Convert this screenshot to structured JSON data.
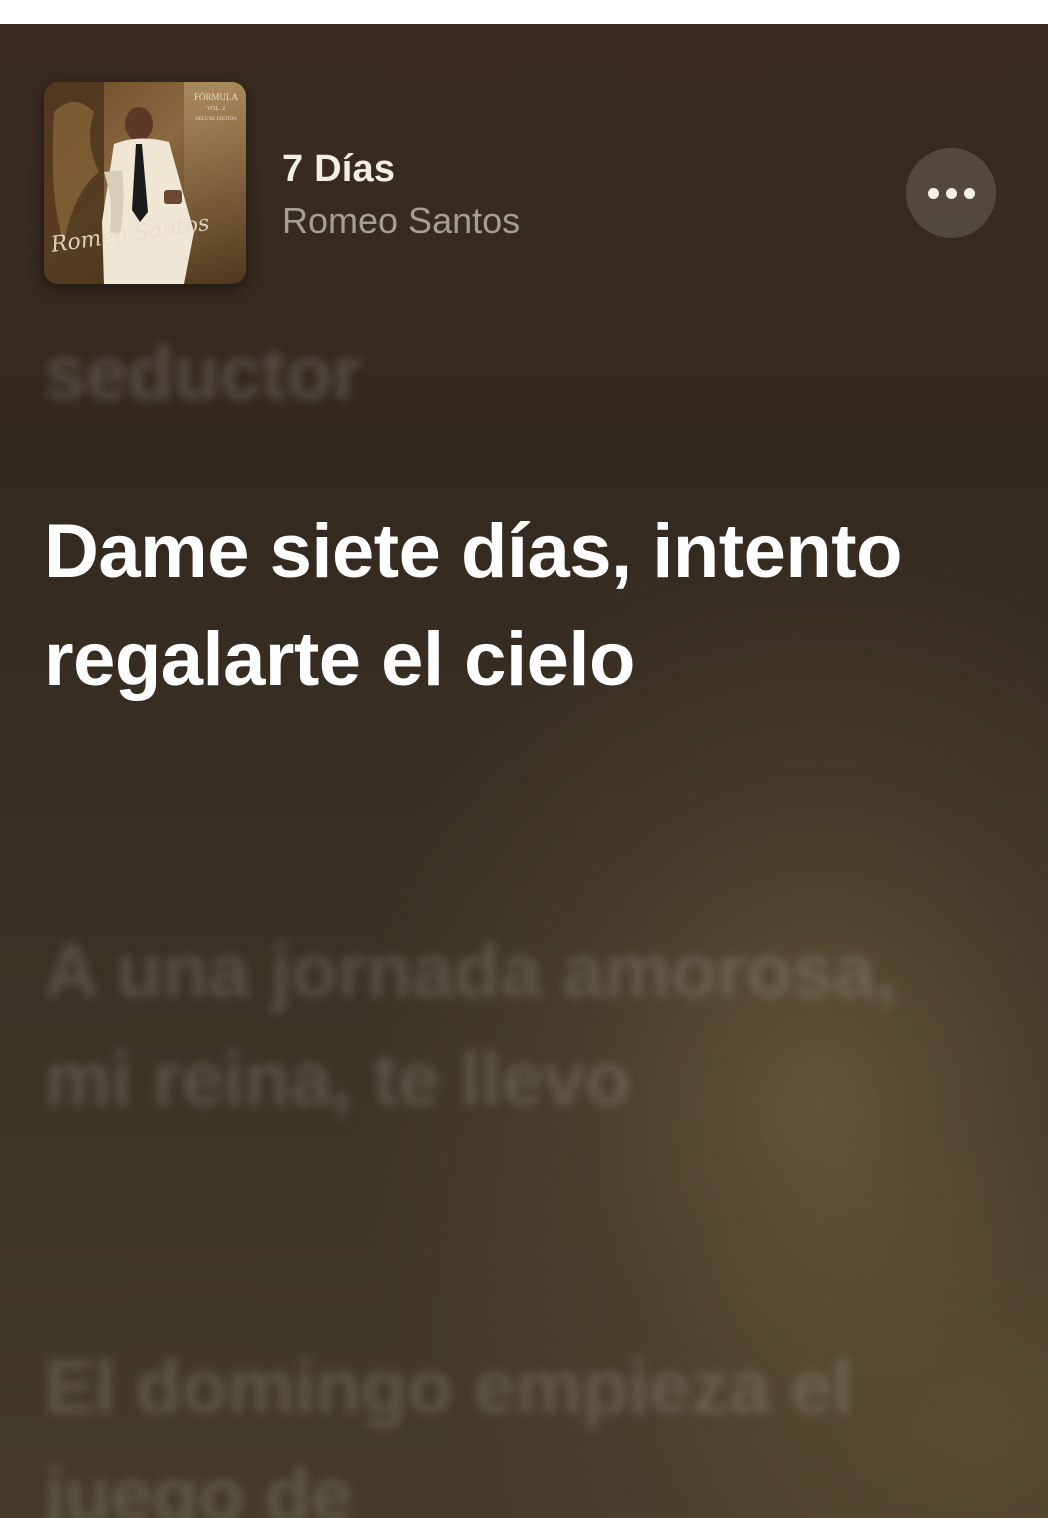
{
  "now_playing": {
    "title": "7 Días",
    "artist": "Romeo Santos",
    "artwork": {
      "album_label": "FÓRMULA",
      "volume": "VOL. 2",
      "edition": "DELUXE EDITION",
      "artist_script": "Romeo Santos"
    },
    "more_icon": "ellipsis-icon"
  },
  "lyrics": {
    "previous": "seductor",
    "current": "Dame siete días, intento regalarte el cielo",
    "next": [
      "A una jornada amorosa, mi reina, te llevo",
      "El domingo empieza el juego de"
    ]
  },
  "colors": {
    "background_top": "#3a2a1f",
    "background_bottom": "#463b2a",
    "active_lyric": "#ffffff",
    "artist_text": "#a59e93"
  }
}
